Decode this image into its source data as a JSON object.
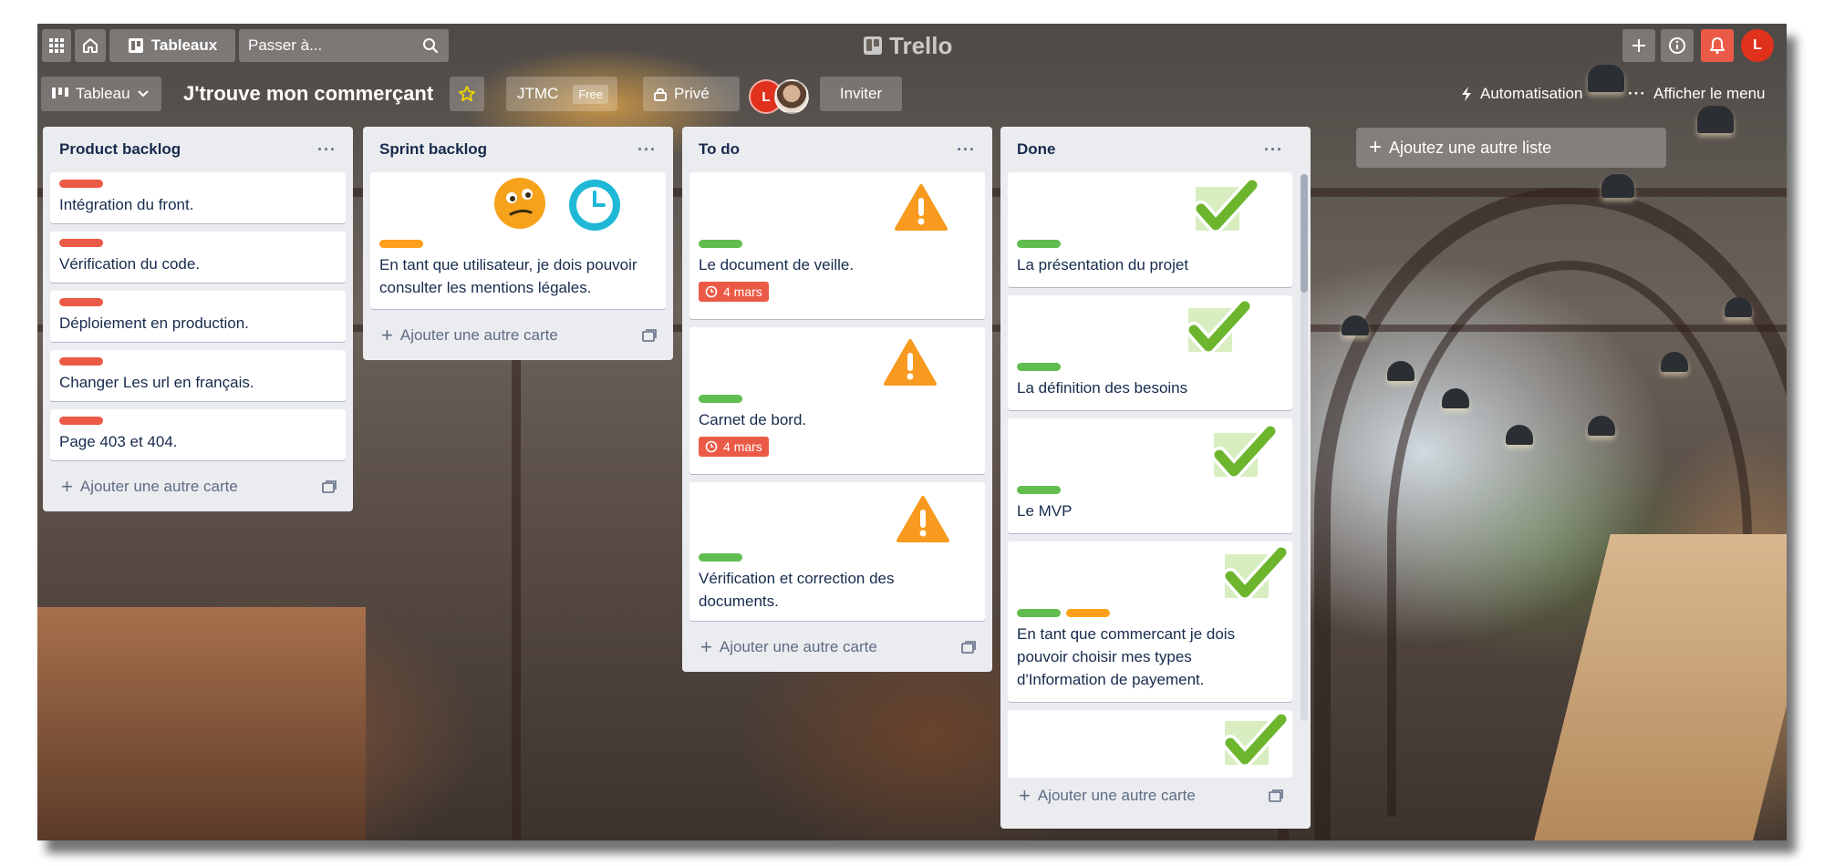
{
  "topbar": {
    "apps_icon": "grid-icon",
    "home_icon": "home-icon",
    "boards_label": "Tableaux",
    "search_placeholder": "Passer à...",
    "logo_text": "Trello",
    "avatar_initial": "L"
  },
  "board_header": {
    "view_label": "Tableau",
    "title": "J'trouve mon commerçant",
    "workspace": "JTMC",
    "workspace_badge": "Free",
    "visibility": "Privé",
    "member_initial": "L",
    "invite_label": "Inviter",
    "automation_label": "Automatisation",
    "menu_label": "Afficher le menu"
  },
  "colors": {
    "red_label": "#eb5a46",
    "orange_label": "#ff9f1a",
    "green_label": "#61bd4f",
    "due_badge": "#eb5a46",
    "notification": "#eb5a46"
  },
  "lists": [
    {
      "name": "Product backlog",
      "cards": [
        {
          "title": "Intégration du front.",
          "labels": [
            "red"
          ]
        },
        {
          "title": "Vérification du code.",
          "labels": [
            "red"
          ]
        },
        {
          "title": "Déploiement en production.",
          "labels": [
            "red"
          ]
        },
        {
          "title": "Changer Les url en français.",
          "labels": [
            "red"
          ]
        },
        {
          "title": "Page 403 et 404.",
          "labels": [
            "red"
          ]
        }
      ],
      "add_card": "Ajouter une autre carte"
    },
    {
      "name": "Sprint backlog",
      "cards": [
        {
          "title": "En tant que utilisateur, je dois pouvoir consulter les mentions légales.",
          "labels": [
            "orange"
          ],
          "stickers": [
            "thinking-face-icon",
            "clock-icon"
          ]
        }
      ],
      "add_card": "Ajouter une autre carte"
    },
    {
      "name": "To do",
      "cards": [
        {
          "title": "Le document de veille.",
          "labels": [
            "green"
          ],
          "due": "4 mars",
          "stickers": [
            "warning-icon"
          ]
        },
        {
          "title": "Carnet de bord.",
          "labels": [
            "green"
          ],
          "due": "4 mars",
          "stickers": [
            "warning-icon"
          ]
        },
        {
          "title": "Vérification et correction des documents.",
          "labels": [
            "green"
          ],
          "stickers": [
            "warning-icon"
          ]
        }
      ],
      "add_card": "Ajouter une autre carte"
    },
    {
      "name": "Done",
      "cards": [
        {
          "title": "La présentation du projet",
          "labels": [
            "green"
          ],
          "stickers": [
            "checkmark-icon"
          ]
        },
        {
          "title": "La définition des besoins",
          "labels": [
            "green"
          ],
          "stickers": [
            "checkmark-icon"
          ]
        },
        {
          "title": "Le MVP",
          "labels": [
            "green"
          ],
          "stickers": [
            "checkmark-icon"
          ]
        },
        {
          "title": "En tant que commercant je dois pouvoir choisir mes types d'Information de payement.",
          "labels": [
            "green",
            "orange"
          ],
          "stickers": [
            "checkmark-icon"
          ]
        },
        {
          "title": "",
          "labels": [
            "orange"
          ],
          "stickers": [
            "checkmark-icon"
          ]
        }
      ],
      "add_card": "Ajouter une autre carte"
    }
  ],
  "add_list": "Ajoutez une autre liste"
}
